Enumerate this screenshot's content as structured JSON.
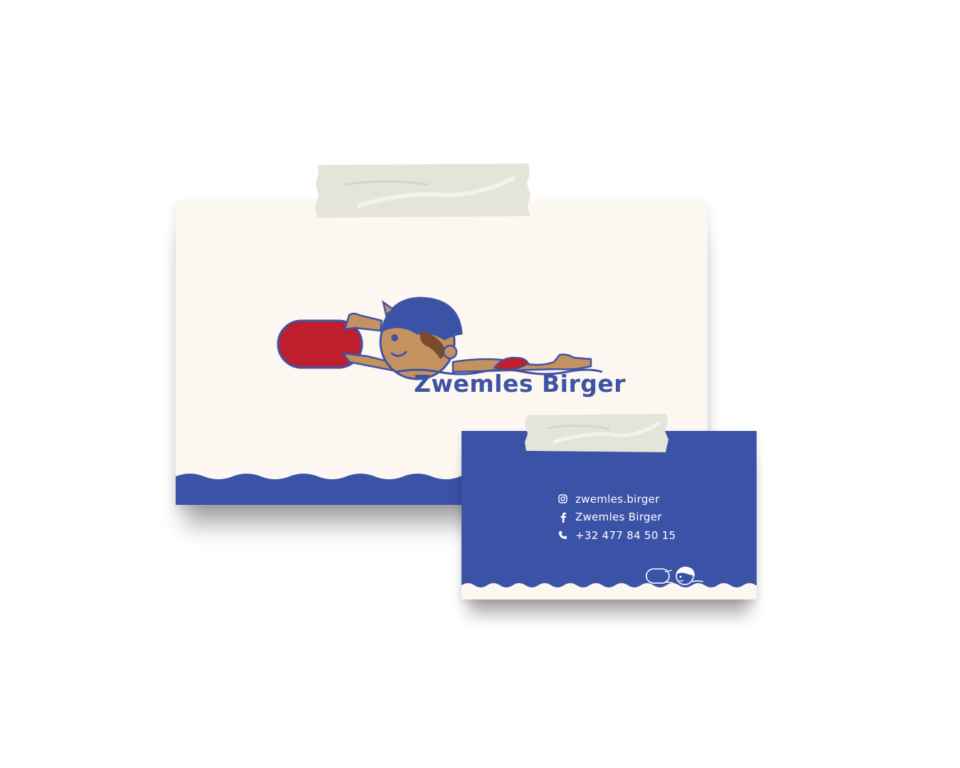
{
  "colors": {
    "brand_blue": "#3b53a7",
    "cream": "#fdf7f1",
    "board_red": "#bf1e2d",
    "skin": "#c4925e",
    "hair": "#7a4a2c",
    "tape": "#e6e6dc"
  },
  "front_card": {
    "brand_name": "Zwemles Birger",
    "logo_icon": "swimmer-with-kickboard"
  },
  "back_card": {
    "contacts": [
      {
        "icon": "instagram-icon",
        "label": "zwemles.birger"
      },
      {
        "icon": "facebook-icon",
        "label": "Zwemles Birger"
      },
      {
        "icon": "phone-icon",
        "label": "+32 477 84 50 15"
      }
    ],
    "mini_logo_icon": "swimmer-outline"
  }
}
